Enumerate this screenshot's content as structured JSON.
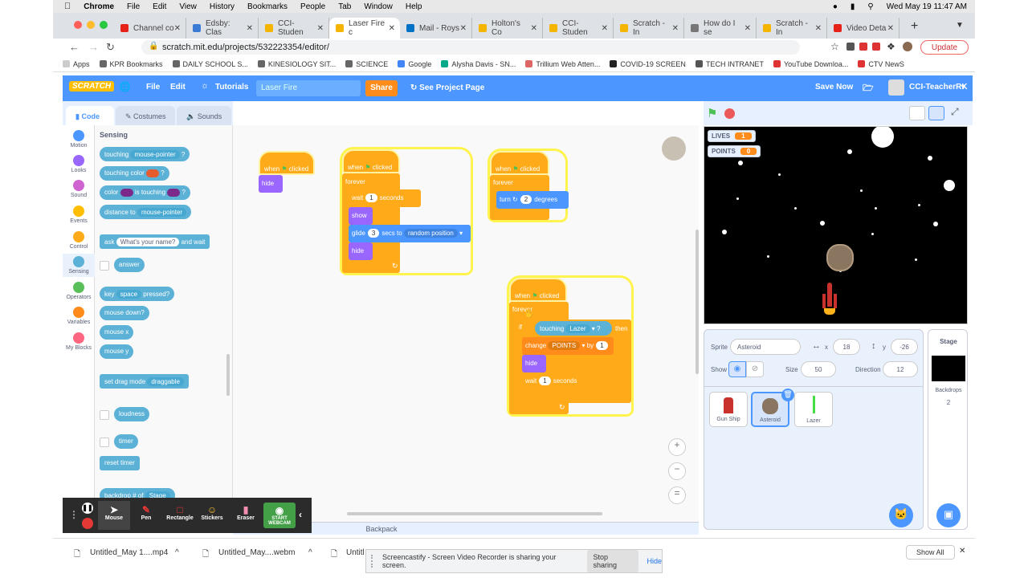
{
  "macbar": {
    "app": "Chrome",
    "menus": [
      "File",
      "Edit",
      "View",
      "History",
      "Bookmarks",
      "People",
      "Tab",
      "Window",
      "Help"
    ],
    "clock": "Wed May 19  11:47 AM"
  },
  "tabs": [
    {
      "label": "Channel co",
      "color": "#e62117"
    },
    {
      "label": "Edsby: Clas",
      "color": "#3a7bd5"
    },
    {
      "label": "CCI-Studen",
      "color": "#f4b400"
    },
    {
      "label": "Laser Fire c",
      "color": "#f4b400"
    },
    {
      "label": "Mail - Roys",
      "color": "#0072c6"
    },
    {
      "label": "Holton's Co",
      "color": "#f4b400"
    },
    {
      "label": "CCI-Studen",
      "color": "#f4b400"
    },
    {
      "label": "Scratch - In",
      "color": "#f4b400"
    },
    {
      "label": "How do I se",
      "color": "#777"
    },
    {
      "label": "Scratch - In",
      "color": "#f4b400"
    },
    {
      "label": "Video Deta",
      "color": "#e62117"
    }
  ],
  "url": "scratch.mit.edu/projects/532223354/editor/",
  "update_label": "Update",
  "bookmarks": [
    "Apps",
    "KPR Bookmarks",
    "DAILY SCHOOL S...",
    "KINESIOLOGY SIT...",
    "SCIENCE",
    "Google",
    "Alysha Davis - SN...",
    "Trillium Web Atten...",
    "COVID-19 SCREEN",
    "TECH INTRANET",
    "YouTube Downloa...",
    "CTV NewS"
  ],
  "scratch_menu": {
    "logo": "SCRATCH",
    "file": "File",
    "edit": "Edit",
    "tutorials": "Tutorials",
    "title": "Laser Fire",
    "share": "Share",
    "see_page": "See Project Page",
    "save": "Save Now",
    "user": "CCI-TeacherRK"
  },
  "editor_tabs": {
    "code": "Code",
    "costumes": "Costumes",
    "sounds": "Sounds"
  },
  "categories": [
    {
      "label": "Motion",
      "color": "#4c97ff"
    },
    {
      "label": "Looks",
      "color": "#9966ff"
    },
    {
      "label": "Sound",
      "color": "#cf63cf"
    },
    {
      "label": "Events",
      "color": "#ffbf00"
    },
    {
      "label": "Control",
      "color": "#ffab19"
    },
    {
      "label": "Sensing",
      "color": "#5cb1d6"
    },
    {
      "label": "Operators",
      "color": "#59c059"
    },
    {
      "label": "Variables",
      "color": "#ff8c1a"
    },
    {
      "label": "My Blocks",
      "color": "#ff6680"
    }
  ],
  "palette": {
    "heading": "Sensing",
    "touching": "touching",
    "mouse_pointer": "mouse-pointer",
    "q": "?",
    "touching_color": "touching color",
    "color": "color",
    "is_touching": "is touching",
    "distance_to": "distance to",
    "ask": "ask",
    "ask_default": "What's your name?",
    "and_wait": "and wait",
    "answer": "answer",
    "key": "key",
    "space": "space",
    "pressed": "pressed?",
    "mouse_down": "mouse down?",
    "mouse_x": "mouse x",
    "mouse_y": "mouse y",
    "set_drag": "set drag mode",
    "draggable": "draggable",
    "loudness": "loudness",
    "timer": "timer",
    "reset_timer": "reset timer",
    "backdrop": "backdrop #",
    "of": "of",
    "stage": "Stage"
  },
  "scripts": {
    "when": "when",
    "clicked": "clicked",
    "hide": "hide",
    "show": "show",
    "forever": "forever",
    "wait": "wait",
    "seconds": "seconds",
    "one": "1",
    "three": "3",
    "two": "2",
    "glide": "glide",
    "secs_to": "secs to",
    "random_position": "random position",
    "turn": "turn",
    "degrees": "degrees",
    "if": "if",
    "then": "then",
    "touching": "touching",
    "lazer": "Lazer",
    "change": "change",
    "points": "POINTS",
    "by": "by"
  },
  "stage": {
    "lives_label": "LIVES",
    "lives_value": "1",
    "points_label": "POINTS",
    "points_value": "0"
  },
  "sprite_info": {
    "sprite_label": "Sprite",
    "sprite_name": "Asteroid",
    "x_label": "x",
    "x": "18",
    "y_label": "y",
    "y": "-26",
    "show_label": "Show",
    "size_label": "Size",
    "size": "50",
    "direction_label": "Direction",
    "direction": "12"
  },
  "sprites": [
    "Gun Ship",
    "Asteroid",
    "Lazer"
  ],
  "stage_pane": {
    "title": "Stage",
    "backdrops_label": "Backdrops",
    "backdrops": "2"
  },
  "backpack": "Backpack",
  "screencastify": {
    "mouse": "Mouse",
    "pen": "Pen",
    "rectangle": "Rectangle",
    "stickers": "Stickers",
    "eraser": "Eraser",
    "webcam": "START WEBCAM"
  },
  "downloads": [
    "Untitled_May 1....mp4",
    "Untitled_May....webm",
    "Untitl"
  ],
  "show_all": "Show All",
  "sharing": {
    "message": "Screencastify - Screen Video Recorder is sharing your screen.",
    "stop": "Stop sharing",
    "hide": "Hide"
  }
}
